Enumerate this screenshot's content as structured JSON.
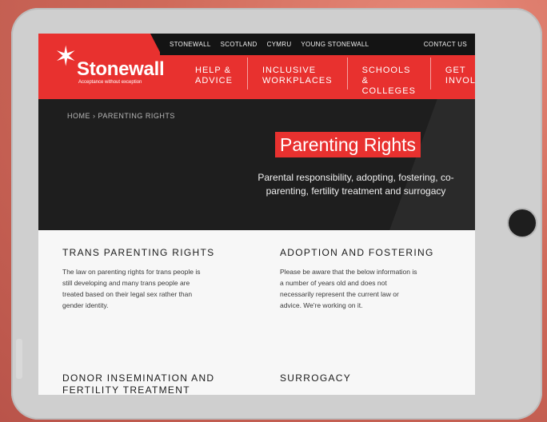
{
  "topbar": {
    "links": [
      "STONEWALL",
      "SCOTLAND",
      "CYMRU",
      "YOUNG STONEWALL"
    ],
    "contact": "CONTACT US"
  },
  "logo": {
    "name": "Stonewall",
    "tagline": "Acceptance without exception"
  },
  "nav": {
    "items": [
      "HELP &\nADVICE",
      "INCLUSIVE\nWORKPLACES",
      "SCHOOLS &\nCOLLEGES",
      "GET\nINVOLVED"
    ]
  },
  "hero": {
    "breadcrumb": "HOME › PARENTING RIGHTS",
    "title": "Parenting Rights",
    "subtitle": "Parental responsibility, adopting, fostering, co-parenting, fertility treatment and surrogacy"
  },
  "sections": [
    {
      "title": "TRANS PARENTING RIGHTS",
      "text": "The law on parenting rights for trans people is still developing and many trans people are treated based on their legal sex rather than gender identity."
    },
    {
      "title": "ADOPTION AND FOSTERING",
      "text": "Please be aware that the below information is a number of years old and does not necessarily represent the current law or advice. We're working on it."
    },
    {
      "title": "DONOR INSEMINATION AND FERTILITY TREATMENT",
      "text": ""
    },
    {
      "title": "SURROGACY",
      "text": ""
    }
  ],
  "colors": {
    "brand_red": "#e8312f",
    "hero_dark": "#1e1e1e",
    "background": "#cf6a5a"
  }
}
